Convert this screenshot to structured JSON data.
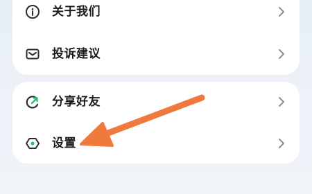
{
  "menu": {
    "group1": [
      {
        "label": "关于我们",
        "icon": "info-circle-icon"
      },
      {
        "label": "投诉建议",
        "icon": "mail-icon"
      }
    ],
    "group2": [
      {
        "label": "分享好友",
        "icon": "share-refresh-icon"
      },
      {
        "label": "设置",
        "icon": "gear-icon"
      }
    ]
  },
  "annotation": {
    "arrow_color": "#f07a3e",
    "points_to": "设置"
  }
}
